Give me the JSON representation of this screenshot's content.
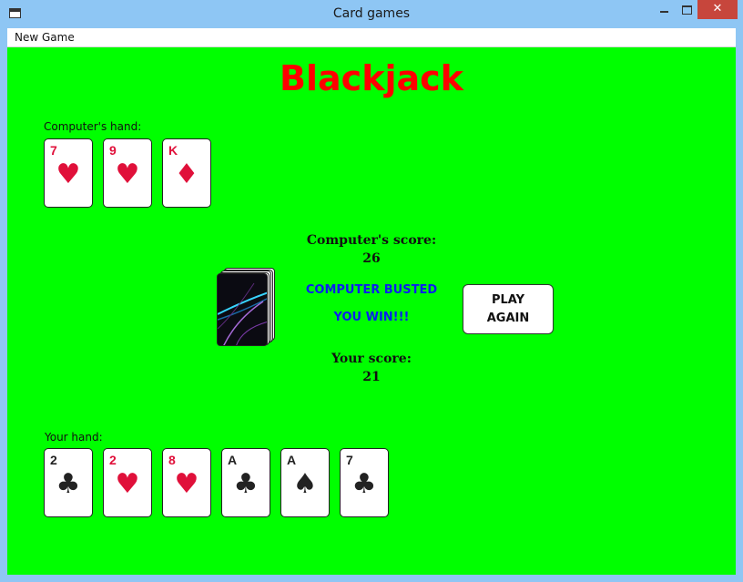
{
  "window": {
    "title": "Card games"
  },
  "menu": {
    "new_game": "New Game"
  },
  "game": {
    "title": "Blackjack",
    "computer_hand_label": "Computer's hand:",
    "your_hand_label": "Your hand:",
    "computer_score_label": "Computer's score:",
    "computer_score": "26",
    "status_line1": "COMPUTER BUSTED",
    "status_line2": "YOU WIN!!!",
    "your_score_label": "Your score:",
    "your_score": "21",
    "play_again": "PLAY AGAIN"
  },
  "computer_cards": [
    {
      "rank": "7",
      "suit": "♥",
      "suit_name": "hearts-icon",
      "color": "red"
    },
    {
      "rank": "9",
      "suit": "♥",
      "suit_name": "hearts-icon",
      "color": "red"
    },
    {
      "rank": "K",
      "suit": "♦",
      "suit_name": "diamonds-icon",
      "color": "red"
    }
  ],
  "player_cards": [
    {
      "rank": "2",
      "suit": "♣",
      "suit_name": "clubs-icon",
      "color": "black"
    },
    {
      "rank": "2",
      "suit": "♥",
      "suit_name": "hearts-icon",
      "color": "red"
    },
    {
      "rank": "8",
      "suit": "♥",
      "suit_name": "hearts-icon",
      "color": "red"
    },
    {
      "rank": "A",
      "suit": "♣",
      "suit_name": "clubs-icon",
      "color": "black"
    },
    {
      "rank": "A",
      "suit": "♠",
      "suit_name": "spades-icon",
      "color": "black"
    },
    {
      "rank": "7",
      "suit": "♣",
      "suit_name": "clubs-icon",
      "color": "black"
    }
  ],
  "colors": {
    "table": "#00ff00",
    "title": "#ff0000",
    "status": "#0a1ef0",
    "red_suit": "#e0103a"
  }
}
